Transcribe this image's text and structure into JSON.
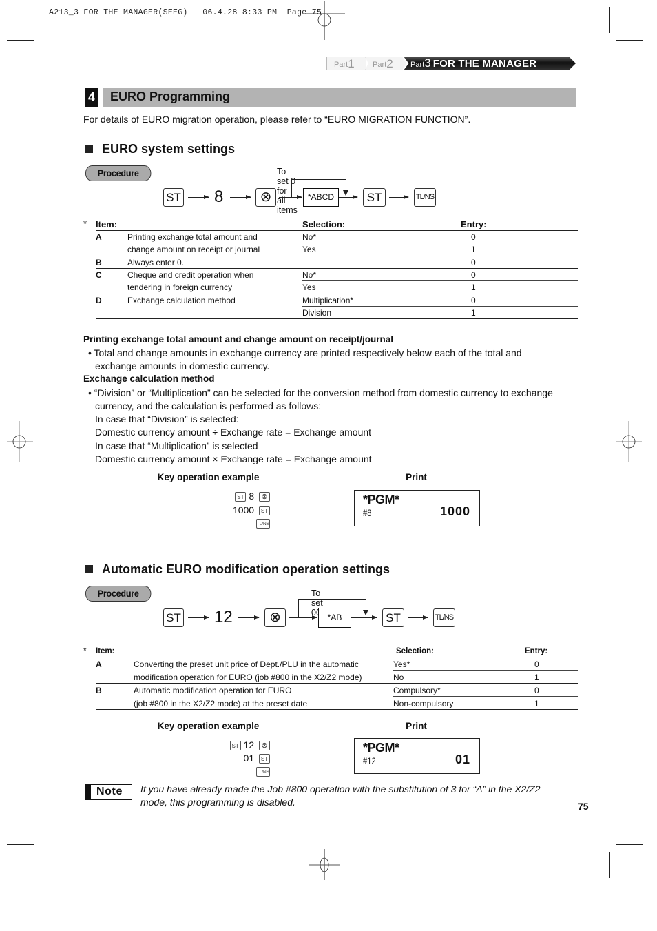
{
  "print_slug": {
    "job": "A213_3 FOR THE MANAGER(SEEG)",
    "datetime": "06.4.28 8:33 PM",
    "page_label": "Page 75"
  },
  "part_tabs": [
    {
      "prefix": "Part",
      "num": "1"
    },
    {
      "prefix": "Part",
      "num": "2"
    },
    {
      "prefix": "Part",
      "num": "3",
      "title": "FOR THE MANAGER",
      "active": true
    }
  ],
  "section": {
    "number": "4",
    "title": "EURO Programming",
    "intro": "For details of EURO migration operation, please refer to “EURO MIGRATION FUNCTION”."
  },
  "euro_system": {
    "heading": "EURO system settings",
    "procedure_label": "Procedure",
    "flow": {
      "key_st": "ST",
      "code": "8",
      "key_x": "⊗",
      "input": "*ABCD",
      "key_tlns": "TL/NS",
      "skip_note": "To set  0  for all items"
    },
    "table": {
      "asterisk": "*",
      "headers": {
        "item": "Item:",
        "selection": "Selection:",
        "entry": "Entry:"
      },
      "rows": [
        {
          "key": "A",
          "desc": [
            "Printing exchange total amount and",
            "change amount on receipt or journal"
          ],
          "options": [
            {
              "sel": "No*",
              "entry": "0"
            },
            {
              "sel": "Yes",
              "entry": "1"
            }
          ]
        },
        {
          "key": "B",
          "desc": [
            "Always enter 0."
          ],
          "options": [
            {
              "sel": "",
              "entry": "0"
            }
          ]
        },
        {
          "key": "C",
          "desc": [
            "Cheque and credit operation when",
            "tendering in foreign currency"
          ],
          "options": [
            {
              "sel": "No*",
              "entry": "0"
            },
            {
              "sel": "Yes",
              "entry": "1"
            }
          ]
        },
        {
          "key": "D",
          "desc": [
            "Exchange calculation method"
          ],
          "options": [
            {
              "sel": "Multiplication*",
              "entry": "0"
            },
            {
              "sel": "Division",
              "entry": "1"
            }
          ]
        }
      ]
    },
    "notes": {
      "h1": "Printing exchange total amount and change amount on receipt/journal",
      "b1_line1": "• Total and change amounts in exchange currency are printed respectively below each of the total and",
      "b1_line2": "exchange amounts in domestic currency.",
      "h2": "Exchange calculation method",
      "b2_line1": "• “Division” or “Multiplication” can be selected for the conversion method from domestic currency to exchange",
      "b2_line2": "currency, and the calculation is performed as follows:",
      "b2_line3": "In case that “Division” is selected:",
      "b2_line4": "Domestic currency amount ÷ Exchange rate = Exchange amount",
      "b2_line5": "In case that “Multiplication” is selected",
      "b2_line6": "Domestic currency amount × Exchange rate = Exchange amount"
    },
    "example": {
      "key_op_label": "Key operation example",
      "print_label": "Print",
      "line1_code": "8",
      "line2_value": "1000",
      "keys": {
        "st": "ST",
        "x": "⊗",
        "tlns": "TL/NS"
      },
      "receipt": {
        "title": "*PGM*",
        "job": "#8",
        "value": "1000"
      }
    }
  },
  "auto_euro": {
    "heading": "Automatic EURO modification operation settings",
    "procedure_label": "Procedure",
    "flow": {
      "key_st": "ST",
      "code": "12",
      "key_x": "⊗",
      "input": "*AB",
      "key_tlns": "TL/NS",
      "skip_note": "To set  00"
    },
    "table": {
      "asterisk": "*",
      "headers": {
        "item": "Item:",
        "selection": "Selection:",
        "entry": "Entry:"
      },
      "rows": [
        {
          "key": "A",
          "desc": [
            "Converting the preset unit price of Dept./PLU in the automatic",
            "modification operation for EURO (job #800 in the X2/Z2 mode)"
          ],
          "options": [
            {
              "sel": "Yes*",
              "entry": "0"
            },
            {
              "sel": "No",
              "entry": "1"
            }
          ]
        },
        {
          "key": "B",
          "desc": [
            "Automatic modification operation for EURO",
            "(job #800 in the X2/Z2 mode) at the preset date"
          ],
          "options": [
            {
              "sel": "Compulsory*",
              "entry": "0"
            },
            {
              "sel": "Non-compulsory",
              "entry": "1"
            }
          ]
        }
      ]
    },
    "example": {
      "key_op_label": "Key operation example",
      "print_label": "Print",
      "line1_code": "12",
      "line2_value": "01",
      "keys": {
        "st": "ST",
        "x": "⊗",
        "tlns": "TL/NS"
      },
      "receipt": {
        "title": "*PGM*",
        "job": "#12",
        "value": "01"
      }
    }
  },
  "note": {
    "label": "Note",
    "text": "If you have already made the Job #800 operation with the substitution of 3 for “A” in the X2/Z2 mode, this programming is disabled."
  },
  "page_number": "75"
}
